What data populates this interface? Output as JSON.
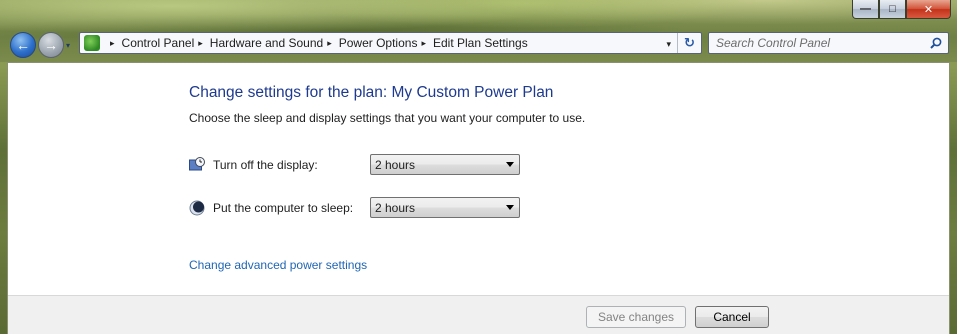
{
  "window": {
    "minimize_glyph": "—",
    "maximize_glyph": "□",
    "close_glyph": "✕"
  },
  "navigation": {
    "back_glyph": "←",
    "forward_glyph": "→",
    "dropdown_glyph": "▾",
    "breadcrumbs": [
      "Control Panel",
      "Hardware and Sound",
      "Power Options",
      "Edit Plan Settings"
    ],
    "separator_glyph": "▸",
    "refresh_glyph": "↻"
  },
  "search": {
    "placeholder": "Search Control Panel"
  },
  "main": {
    "heading": "Change settings for the plan: My Custom Power Plan",
    "subheading": "Choose the sleep and display settings that you want your computer to use.",
    "settings": [
      {
        "label": "Turn off the display:",
        "value": "2 hours",
        "icon": "display-clock-icon"
      },
      {
        "label": "Put the computer to sleep:",
        "value": "2 hours",
        "icon": "sleep-moon-icon"
      }
    ],
    "advanced_link": "Change advanced power settings"
  },
  "footer": {
    "save_label": "Save changes",
    "cancel_label": "Cancel"
  },
  "colors": {
    "heading": "#1e3a8f",
    "link": "#1f66b3",
    "disabled_text": "#838383"
  }
}
